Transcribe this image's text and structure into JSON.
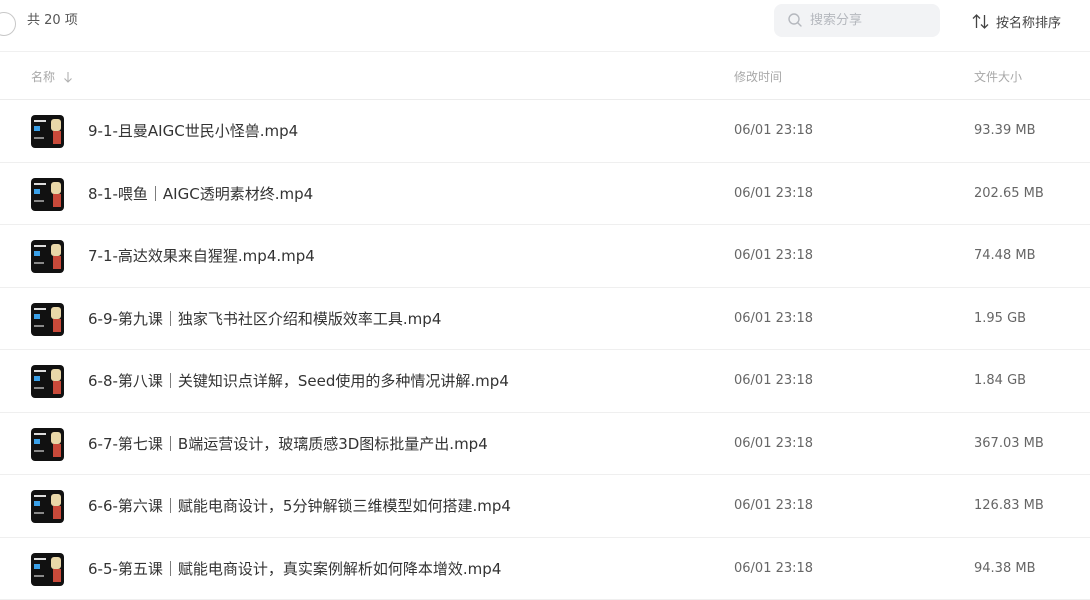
{
  "toolbar": {
    "count_label": "共 20 项",
    "search_placeholder": "搜索分享",
    "sort_label": "按名称排序"
  },
  "columns": {
    "name": "名称",
    "modified": "修改时间",
    "size": "文件大小"
  },
  "files": [
    {
      "name": "9-1-且曼AIGC世民小怪兽.mp4",
      "modified": "06/01 23:18",
      "size": "93.39 MB"
    },
    {
      "name": "8-1-喂鱼｜AIGC透明素材终.mp4",
      "modified": "06/01 23:18",
      "size": "202.65 MB"
    },
    {
      "name": "7-1-高达效果来自猩猩.mp4.mp4",
      "modified": "06/01 23:18",
      "size": "74.48 MB"
    },
    {
      "name": "6-9-第九课｜独家飞书社区介绍和模版效率工具.mp4",
      "modified": "06/01 23:18",
      "size": "1.95 GB"
    },
    {
      "name": "6-8-第八课｜关键知识点详解，Seed使用的多种情况讲解.mp4",
      "modified": "06/01 23:18",
      "size": "1.84 GB"
    },
    {
      "name": "6-7-第七课｜B端运营设计，玻璃质感3D图标批量产出.mp4",
      "modified": "06/01 23:18",
      "size": "367.03 MB"
    },
    {
      "name": "6-6-第六课｜赋能电商设计，5分钟解锁三维模型如何搭建.mp4",
      "modified": "06/01 23:18",
      "size": "126.83 MB"
    },
    {
      "name": "6-5-第五课｜赋能电商设计，真实案例解析如何降本增效.mp4",
      "modified": "06/01 23:18",
      "size": "94.38 MB"
    }
  ]
}
